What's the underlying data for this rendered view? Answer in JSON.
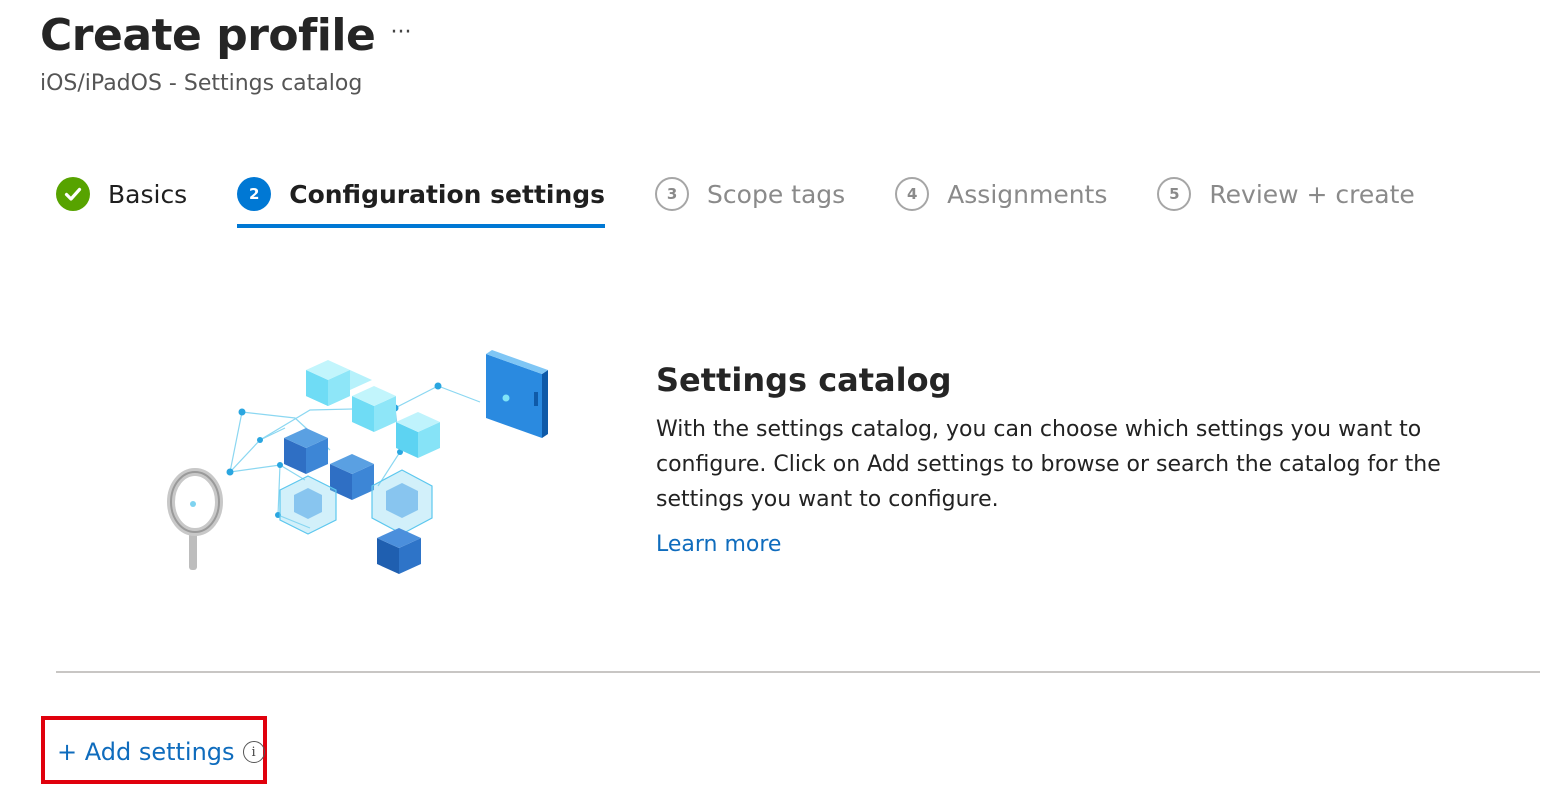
{
  "header": {
    "title": "Create profile",
    "more_label": "···",
    "subtitle": "iOS/iPadOS - Settings catalog"
  },
  "wizard": {
    "steps": [
      {
        "number": "1",
        "label": "Basics",
        "state": "done",
        "icon": "check-icon"
      },
      {
        "number": "2",
        "label": "Configuration settings",
        "state": "active"
      },
      {
        "number": "3",
        "label": "Scope tags",
        "state": "pending"
      },
      {
        "number": "4",
        "label": "Assignments",
        "state": "pending"
      },
      {
        "number": "5",
        "label": "Review + create",
        "state": "pending"
      }
    ]
  },
  "main": {
    "illustration_icon": "settings-catalog-illustration",
    "catalog_title": "Settings catalog",
    "catalog_description": "With the settings catalog, you can choose which settings you want to configure. Click on Add settings to browse or search the catalog for the settings you want to configure.",
    "learn_more_label": "Learn more"
  },
  "footer": {
    "add_settings_label": "+ Add settings",
    "info_glyph": "i"
  },
  "colors": {
    "accent": "#0078d4",
    "link": "#0f6cbd",
    "done": "#57a300",
    "highlight": "#e0000d",
    "muted": "#8a8a8a"
  }
}
